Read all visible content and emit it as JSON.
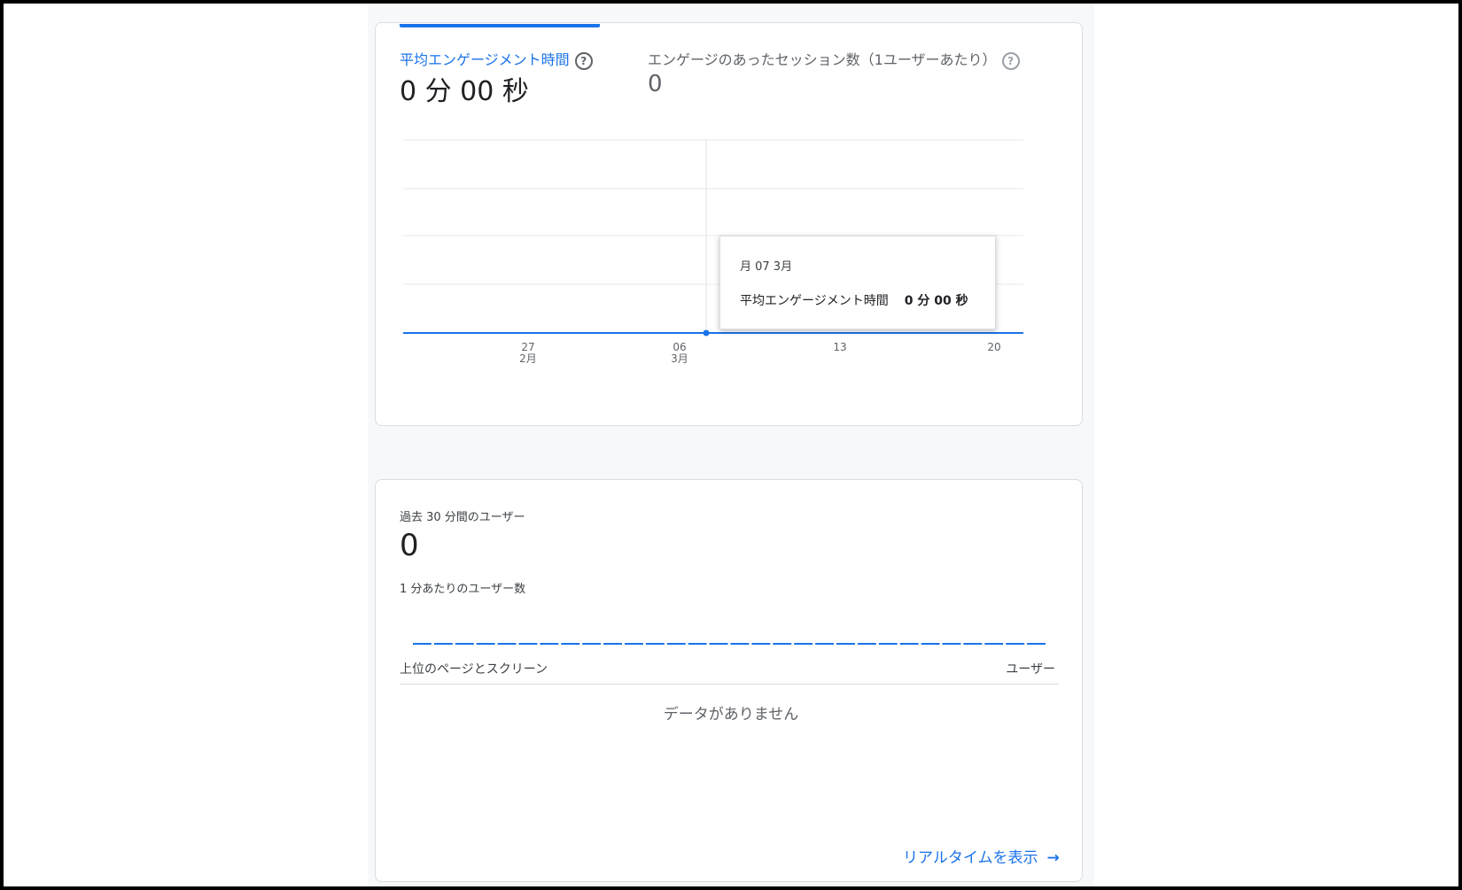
{
  "engagement_card": {
    "metric1": {
      "label": "平均エンゲージメント時間",
      "value": "0 分 00 秒",
      "help": "?"
    },
    "metric2": {
      "label": "エンゲージのあったセッション数（1ユーザーあたり）",
      "value": "0",
      "help": "?"
    }
  },
  "chart_data": {
    "type": "line",
    "series": [
      {
        "values": [
          0,
          0,
          0,
          0,
          0
        ]
      }
    ],
    "x_ticks": [
      {
        "day": "27",
        "month": "2月"
      },
      {
        "day": "06",
        "month": "3月"
      },
      {
        "day": "13",
        "month": ""
      },
      {
        "day": "20",
        "month": ""
      }
    ],
    "grid": true,
    "highlight_point": "07 3月",
    "line_color": "#1a73e8"
  },
  "tooltip": {
    "date": "月 07 3月",
    "metric_label": "平均エンゲージメント時間",
    "metric_value": "0 分 00 秒"
  },
  "realtime_card": {
    "title": "過去 30 分間のユーザー",
    "value": "0",
    "per_minute_label": "1 分あたりのユーザー数",
    "col_pages": "上位のページとスクリーン",
    "col_users": "ユーザー",
    "empty_message": "データがありません",
    "link_label": "リアルタイムを表示",
    "link_arrow": "→"
  },
  "colors": {
    "accent": "#1a73e8",
    "text": "#202124",
    "muted": "#5f6368",
    "border": "#dadce0"
  }
}
